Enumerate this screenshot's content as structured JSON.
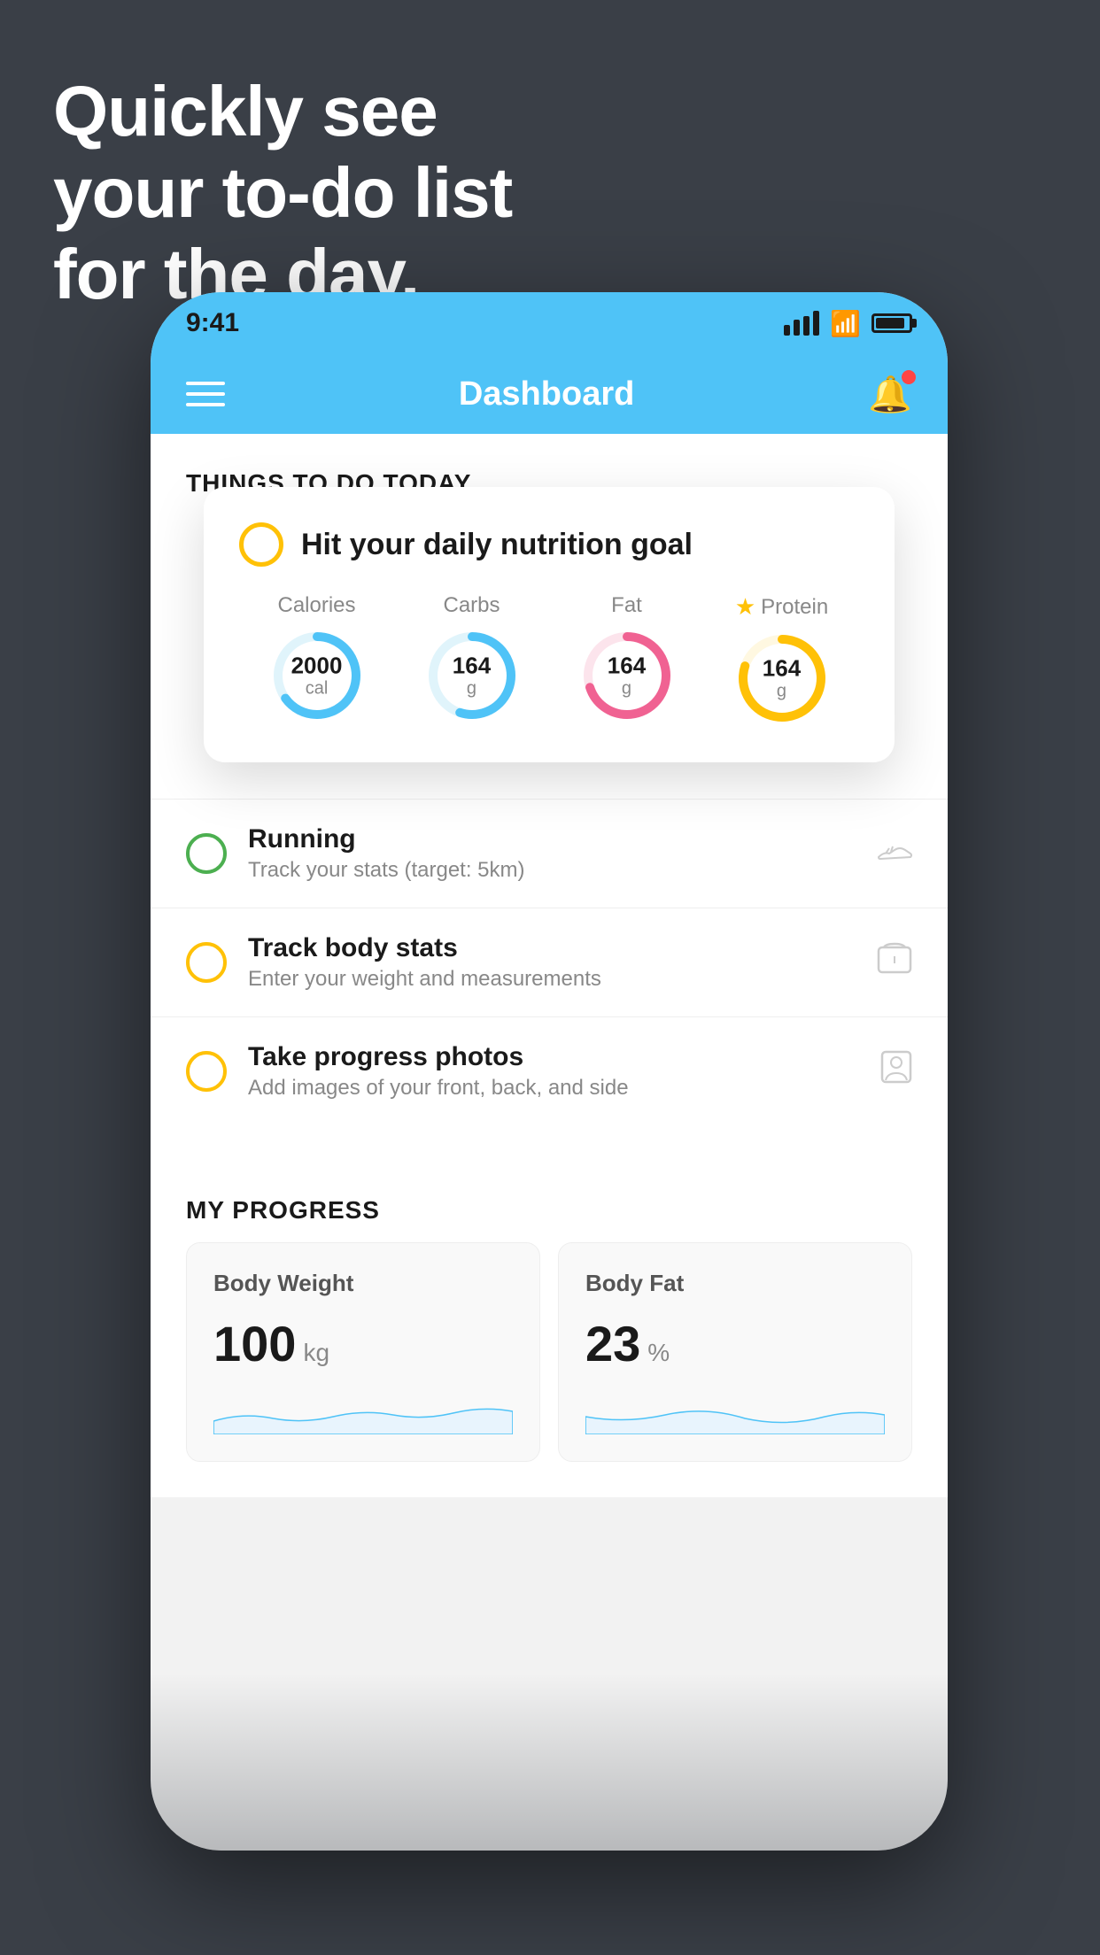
{
  "background": {
    "color": "#3a3f47"
  },
  "headline": {
    "line1": "Quickly see",
    "line2": "your to-do list",
    "line3": "for the day."
  },
  "phone": {
    "status_bar": {
      "time": "9:41"
    },
    "header": {
      "title": "Dashboard"
    },
    "things_section": {
      "label": "THINGS TO DO TODAY"
    },
    "floating_card": {
      "title": "Hit your daily nutrition goal",
      "stats": [
        {
          "label": "Calories",
          "value": "2000",
          "unit": "cal",
          "color": "#4fc3f7",
          "percent": 65,
          "starred": false
        },
        {
          "label": "Carbs",
          "value": "164",
          "unit": "g",
          "color": "#4fc3f7",
          "percent": 55,
          "starred": false
        },
        {
          "label": "Fat",
          "value": "164",
          "unit": "g",
          "color": "#f06292",
          "percent": 70,
          "starred": false
        },
        {
          "label": "Protein",
          "value": "164",
          "unit": "g",
          "color": "#ffc107",
          "percent": 80,
          "starred": true
        }
      ]
    },
    "todo_items": [
      {
        "title": "Running",
        "subtitle": "Track your stats (target: 5km)",
        "circle_color": "green",
        "icon": "shoe"
      },
      {
        "title": "Track body stats",
        "subtitle": "Enter your weight and measurements",
        "circle_color": "yellow",
        "icon": "scale"
      },
      {
        "title": "Take progress photos",
        "subtitle": "Add images of your front, back, and side",
        "circle_color": "yellow",
        "icon": "person"
      }
    ],
    "progress_section": {
      "label": "MY PROGRESS",
      "cards": [
        {
          "title": "Body Weight",
          "value": "100",
          "unit": "kg"
        },
        {
          "title": "Body Fat",
          "value": "23",
          "unit": "%"
        }
      ]
    }
  }
}
